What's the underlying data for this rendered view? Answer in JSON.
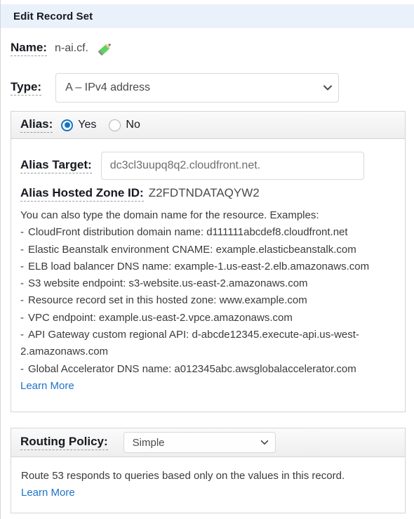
{
  "window": {
    "title": "Edit Record Set"
  },
  "name_field": {
    "label": "Name:",
    "value": "n-ai.cf.",
    "edit_icon": "pencil-icon"
  },
  "type_field": {
    "label": "Type:",
    "selected": "A – IPv4 address",
    "chevron_icon": "chevron-down-icon"
  },
  "alias": {
    "label": "Alias:",
    "options": [
      {
        "label": "Yes",
        "selected": true
      },
      {
        "label": "No",
        "selected": false
      }
    ],
    "target": {
      "label": "Alias Target:",
      "value": "dc3cl3uupq8q2.cloudfront.net."
    },
    "hosted_zone": {
      "label": "Alias Hosted Zone ID:",
      "value": "Z2FDTNDATAQYW2"
    },
    "help": {
      "intro": "You can also type the domain name for the resource. Examples:",
      "examples": [
        "CloudFront distribution domain name: d111111abcdef8.cloudfront.net",
        "Elastic Beanstalk environment CNAME: example.elasticbeanstalk.com",
        "ELB load balancer DNS name: example-1.us-east-2.elb.amazonaws.com",
        "S3 website endpoint: s3-website.us-east-2.amazonaws.com",
        "Resource record set in this hosted zone: www.example.com",
        "VPC endpoint: example.us-east-2.vpce.amazonaws.com",
        "API Gateway custom regional API: d-abcde12345.execute-api.us-west-2.amazonaws.com",
        "Global Accelerator DNS name: a012345abc.awsglobalaccelerator.com"
      ],
      "bullet": "-",
      "learn_more": "Learn More"
    }
  },
  "routing_policy": {
    "label": "Routing Policy:",
    "selected": "Simple",
    "chevron_icon": "chevron-down-icon",
    "description": "Route 53 responds to queries based only on the values in this record.",
    "learn_more": "Learn More"
  },
  "colors": {
    "titlebar_bg": "#eaf1fb",
    "accent_blue": "#1474c4",
    "link_blue": "#1e73c8",
    "panel_border": "#d5d5d5",
    "pencil_green": "#5fd35f"
  }
}
